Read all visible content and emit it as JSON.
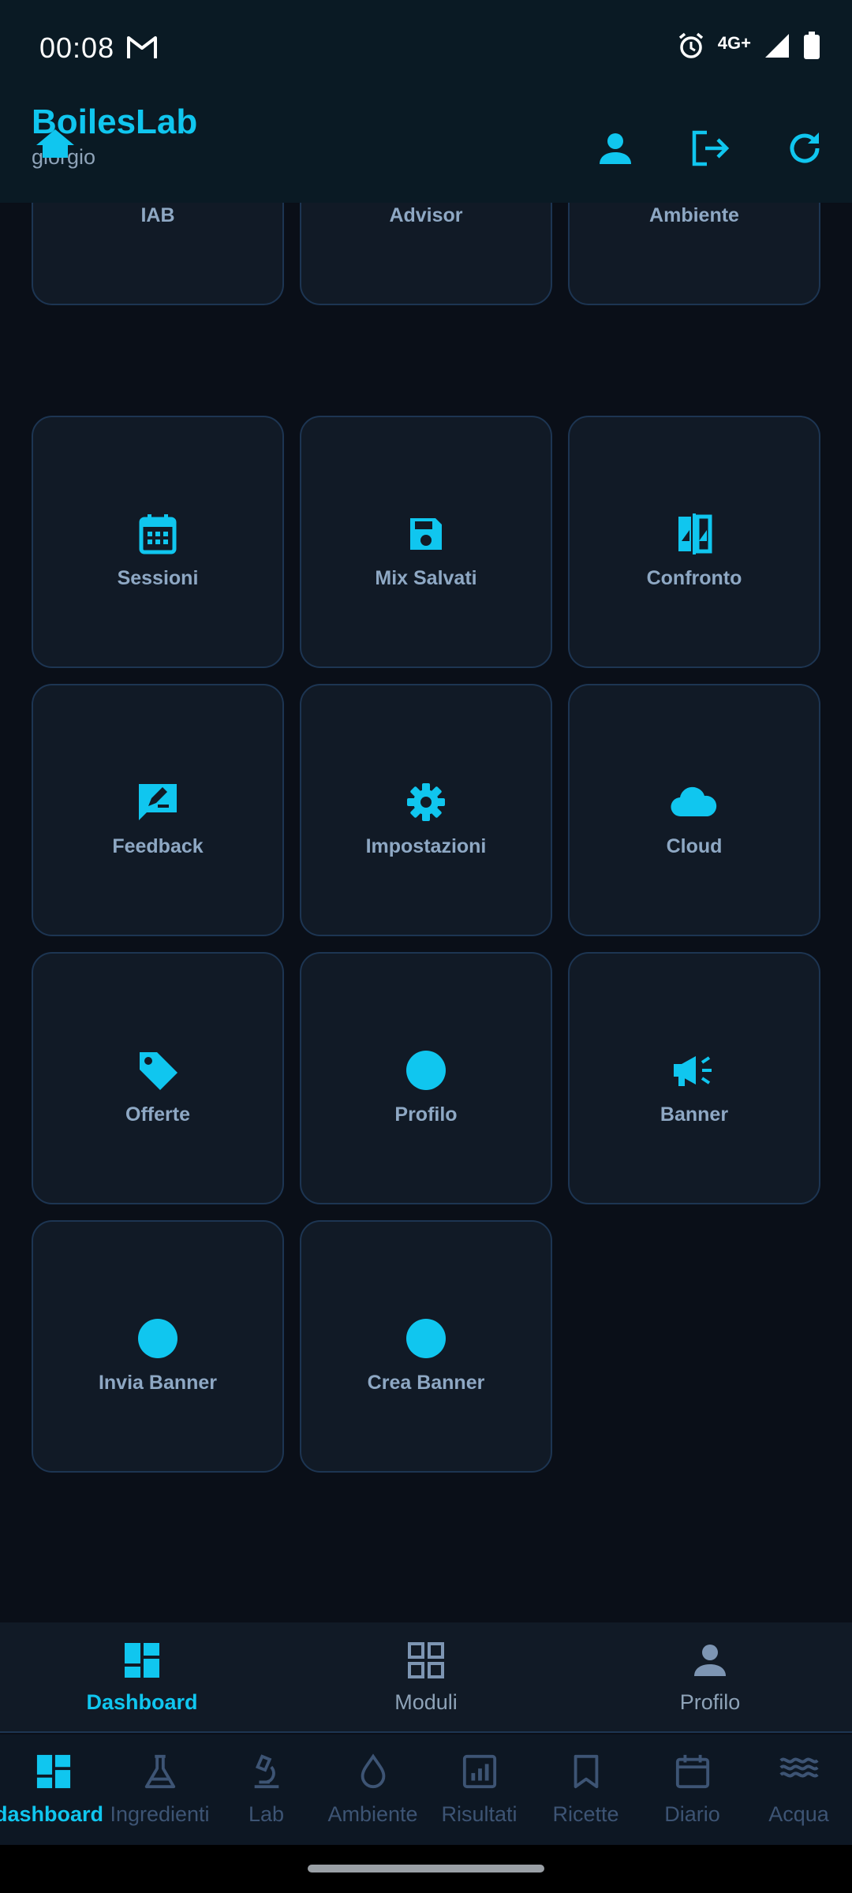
{
  "status_bar": {
    "time": "00:08",
    "network": "4G+"
  },
  "app_bar": {
    "title": "BoilesLab",
    "subtitle": "giorgio"
  },
  "tiles": [
    {
      "label": "IAB",
      "icon": "speedometer-icon"
    },
    {
      "label": "Advisor",
      "icon": "lightbulb-icon"
    },
    {
      "label": "Ambiente",
      "icon": "waves-icon"
    },
    {
      "label": "Sessioni",
      "icon": "calendar-icon"
    },
    {
      "label": "Mix Salvati",
      "icon": "save-icon"
    },
    {
      "label": "Confronto",
      "icon": "compare-icon"
    },
    {
      "label": "Feedback",
      "icon": "feedback-icon"
    },
    {
      "label": "Impostazioni",
      "icon": "gear-icon"
    },
    {
      "label": "Cloud",
      "icon": "cloud-icon"
    },
    {
      "label": "Offerte",
      "icon": "tag-icon"
    },
    {
      "label": "Profilo",
      "icon": "circle-icon"
    },
    {
      "label": "Banner",
      "icon": "megaphone-icon"
    },
    {
      "label": "Invia Banner",
      "icon": "circle-icon"
    },
    {
      "label": "Crea Banner",
      "icon": "circle-icon"
    }
  ],
  "nav_primary": {
    "items": [
      {
        "label": "Dashboard",
        "icon": "dashboard-icon",
        "active": true
      },
      {
        "label": "Moduli",
        "icon": "grid-icon",
        "active": false
      },
      {
        "label": "Profilo",
        "icon": "person-icon",
        "active": false
      }
    ]
  },
  "nav_secondary": {
    "items": [
      {
        "label": "tab_dashboard",
        "icon": "dashboard-icon",
        "active": true
      },
      {
        "label": "Ingredienti",
        "icon": "flask-icon",
        "active": false
      },
      {
        "label": "Lab",
        "icon": "microscope-icon",
        "active": false
      },
      {
        "label": "Ambiente",
        "icon": "drop-icon",
        "active": false
      },
      {
        "label": "Risultati",
        "icon": "chart-icon",
        "active": false
      },
      {
        "label": "Ricette",
        "icon": "bookmark-icon",
        "active": false
      },
      {
        "label": "Diario",
        "icon": "calendar-icon",
        "active": false
      },
      {
        "label": "Acqua",
        "icon": "waves-icon",
        "active": false
      }
    ]
  },
  "colors": {
    "accent": "#10c6ef",
    "background": "#0a0f18",
    "tile": "#111a26",
    "tile_border": "#1d3552",
    "muted": "#5d7594"
  }
}
